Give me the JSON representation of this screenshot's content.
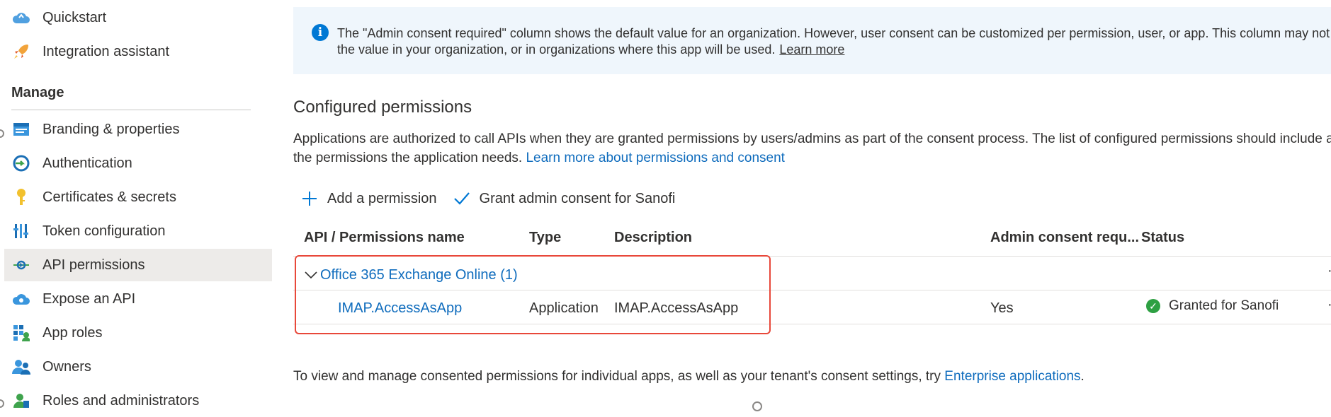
{
  "sidebar": {
    "items_top": [
      {
        "label": "Quickstart",
        "icon": "cloud-quickstart-icon"
      },
      {
        "label": "Integration assistant",
        "icon": "rocket-icon"
      }
    ],
    "manage_heading": "Manage",
    "items": [
      {
        "label": "Branding & properties",
        "icon": "branding-icon"
      },
      {
        "label": "Authentication",
        "icon": "authentication-icon"
      },
      {
        "label": "Certificates & secrets",
        "icon": "key-icon"
      },
      {
        "label": "Token configuration",
        "icon": "token-bars-icon"
      },
      {
        "label": "API permissions",
        "icon": "api-permissions-icon",
        "active": true
      },
      {
        "label": "Expose an API",
        "icon": "expose-api-cloud-icon"
      },
      {
        "label": "App roles",
        "icon": "app-roles-grid-icon"
      },
      {
        "label": "Owners",
        "icon": "owners-people-icon"
      },
      {
        "label": "Roles and administrators",
        "icon": "roles-admin-icon"
      }
    ]
  },
  "info_banner": {
    "text": "The \"Admin consent required\" column shows the default value for an organization. However, user consent can be customized per permission, user, or app. This column may not reflect the value in your organization, or in organizations where this app will be used.",
    "link": "Learn more"
  },
  "configured": {
    "title": "Configured permissions",
    "description": "Applications are authorized to call APIs when they are granted permissions by users/admins as part of the consent process. The list of configured permissions should include all the permissions the application needs.",
    "description_link": "Learn more about permissions and consent"
  },
  "toolbar": {
    "add_permission": "Add a permission",
    "grant_consent": "Grant admin consent for Sanofi"
  },
  "table": {
    "headers": {
      "name": "API / Permissions name",
      "type": "Type",
      "description": "Description",
      "admin_consent": "Admin consent requ...",
      "status": "Status"
    },
    "group": {
      "label": "Office 365 Exchange Online (1)"
    },
    "row": {
      "name": "IMAP.AccessAsApp",
      "type": "Application",
      "description": "IMAP.AccessAsApp",
      "admin_consent": "Yes",
      "status": "Granted for Sanofi"
    }
  },
  "footer": {
    "text": "To view and manage consented permissions for individual apps, as well as your tenant's consent settings, try",
    "link": "Enterprise applications",
    "suffix": "."
  },
  "colors": {
    "link": "#0f6cbd",
    "highlight_box": "#e8483a",
    "info_bg": "#eff6fc",
    "success": "#2ea043"
  }
}
